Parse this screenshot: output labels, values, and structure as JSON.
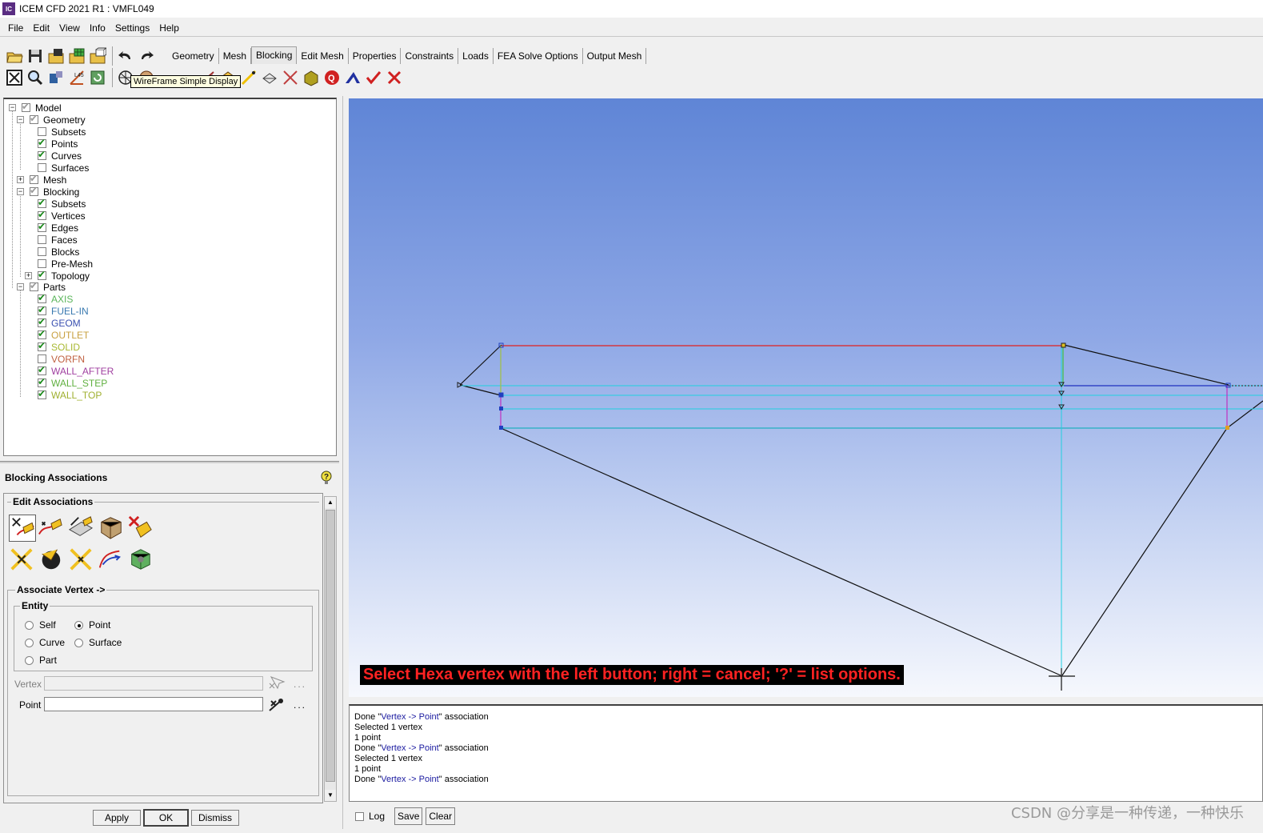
{
  "window": {
    "title": "ICEM CFD 2021 R1 : VMFL049",
    "app_icon": "IC"
  },
  "menu": [
    "File",
    "Edit",
    "View",
    "Info",
    "Settings",
    "Help"
  ],
  "tabs": [
    {
      "label": "Geometry"
    },
    {
      "label": "Mesh"
    },
    {
      "label": "Blocking",
      "active": true
    },
    {
      "label": "Edit Mesh"
    },
    {
      "label": "Properties"
    },
    {
      "label": "Constraints"
    },
    {
      "label": "Loads"
    },
    {
      "label": "FEA Solve Options"
    },
    {
      "label": "Output Mesh"
    }
  ],
  "tooltip": "WireFrame Simple Display",
  "tree": {
    "model": "Model",
    "geometry": "Geometry",
    "geometry_subsets": "Subsets",
    "points": "Points",
    "curves": "Curves",
    "surfaces": "Surfaces",
    "mesh": "Mesh",
    "blocking": "Blocking",
    "blocking_subsets": "Subsets",
    "vertices": "Vertices",
    "edges": "Edges",
    "faces": "Faces",
    "blocks": "Blocks",
    "premesh": "Pre-Mesh",
    "topology": "Topology",
    "parts": "Parts",
    "part_list": [
      {
        "name": "AXIS",
        "color": "#5ab55a",
        "checked": true
      },
      {
        "name": "FUEL-IN",
        "color": "#3a7ab0",
        "checked": true
      },
      {
        "name": "GEOM",
        "color": "#3a50b0",
        "checked": true
      },
      {
        "name": "OUTLET",
        "color": "#c8a040",
        "checked": true
      },
      {
        "name": "SOLID",
        "color": "#a8b830",
        "checked": true
      },
      {
        "name": "VORFN",
        "color": "#c06040",
        "checked": false
      },
      {
        "name": "WALL_AFTER",
        "color": "#a040a0",
        "checked": true
      },
      {
        "name": "WALL_STEP",
        "color": "#60b040",
        "checked": true
      },
      {
        "name": "WALL_TOP",
        "color": "#a0b030",
        "checked": true
      }
    ]
  },
  "panel": {
    "title": "Blocking Associations",
    "edit_associations": "Edit Associations",
    "associate_vertex": "Associate Vertex ->",
    "entity": "Entity",
    "opt_self": "Self",
    "opt_point": "Point",
    "opt_curve": "Curve",
    "opt_surface": "Surface",
    "opt_part": "Part",
    "selected_entity": "Point",
    "vertex_label": "Vertex",
    "vertex_value": "",
    "point_label": "Point",
    "point_value": "",
    "dots": "...",
    "apply": "Apply",
    "ok": "OK",
    "dismiss": "Dismiss"
  },
  "prompt": "Select Hexa vertex with the left button; right = cancel; '?' = list options.",
  "messages": [
    {
      "pre": "Done \"",
      "hl": "Vertex -> Point",
      "post": "\" association"
    },
    {
      "pre": "Selected 1 vertex",
      "hl": "",
      "post": ""
    },
    {
      "pre": "1 point",
      "hl": "",
      "post": ""
    },
    {
      "pre": "Done \"",
      "hl": "Vertex -> Point",
      "post": "\" association"
    },
    {
      "pre": "Selected 1 vertex",
      "hl": "",
      "post": ""
    },
    {
      "pre": "1 point",
      "hl": "",
      "post": ""
    },
    {
      "pre": "Done \"",
      "hl": "Vertex -> Point",
      "post": "\" association"
    }
  ],
  "log": {
    "label": "Log",
    "save": "Save",
    "clear": "Clear"
  },
  "watermark": "CSDN @分享是一种传递，一种快乐"
}
